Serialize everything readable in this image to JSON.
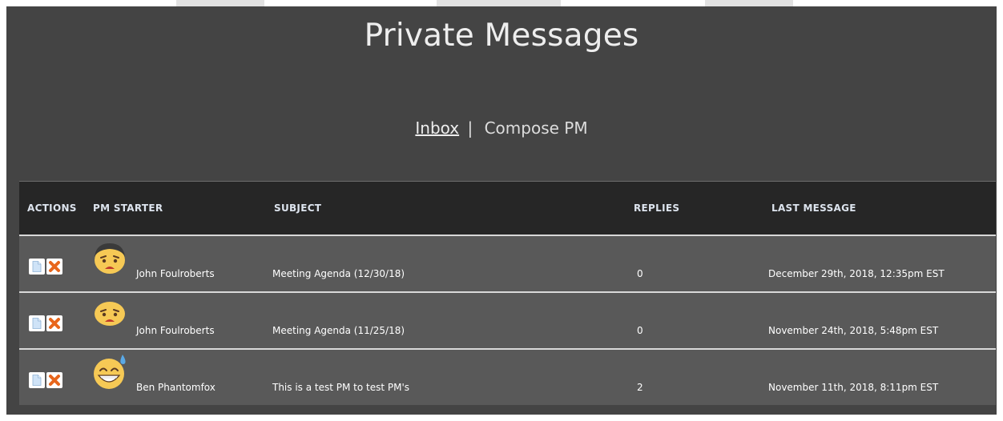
{
  "page": {
    "title": "Private Messages"
  },
  "nav": {
    "inbox_label": "Inbox",
    "separator": "|",
    "compose_label": "Compose PM"
  },
  "table": {
    "headers": {
      "actions": "ACTIONS",
      "starter": "PM STARTER",
      "subject": "SUBJECT",
      "replies": "REPLIES",
      "last_message": "LAST MESSAGE"
    },
    "rows": [
      {
        "starter": "John Foulroberts",
        "subject": "Meeting Agenda (12/30/18)",
        "replies": "0",
        "last_message": "December 29th, 2018, 12:35pm EST",
        "avatar": "sad-face-icon"
      },
      {
        "starter": "John Foulroberts",
        "subject": "Meeting Agenda (11/25/18)",
        "replies": "0",
        "last_message": "November 24th, 2018, 5:48pm EST",
        "avatar": "sad-face-icon"
      },
      {
        "starter": "Ben Phantomfox",
        "subject": "This is a test PM to test PM's",
        "replies": "2",
        "last_message": "November 11th, 2018, 8:11pm EST",
        "avatar": "sweat-smile-icon"
      }
    ]
  },
  "icons": {
    "view": "document-icon",
    "delete": "delete-x-icon"
  },
  "colors": {
    "panel": "#444444",
    "header": "#262626",
    "row": "#595959",
    "delete": "#e8661c",
    "avatar": "#f6c955"
  }
}
